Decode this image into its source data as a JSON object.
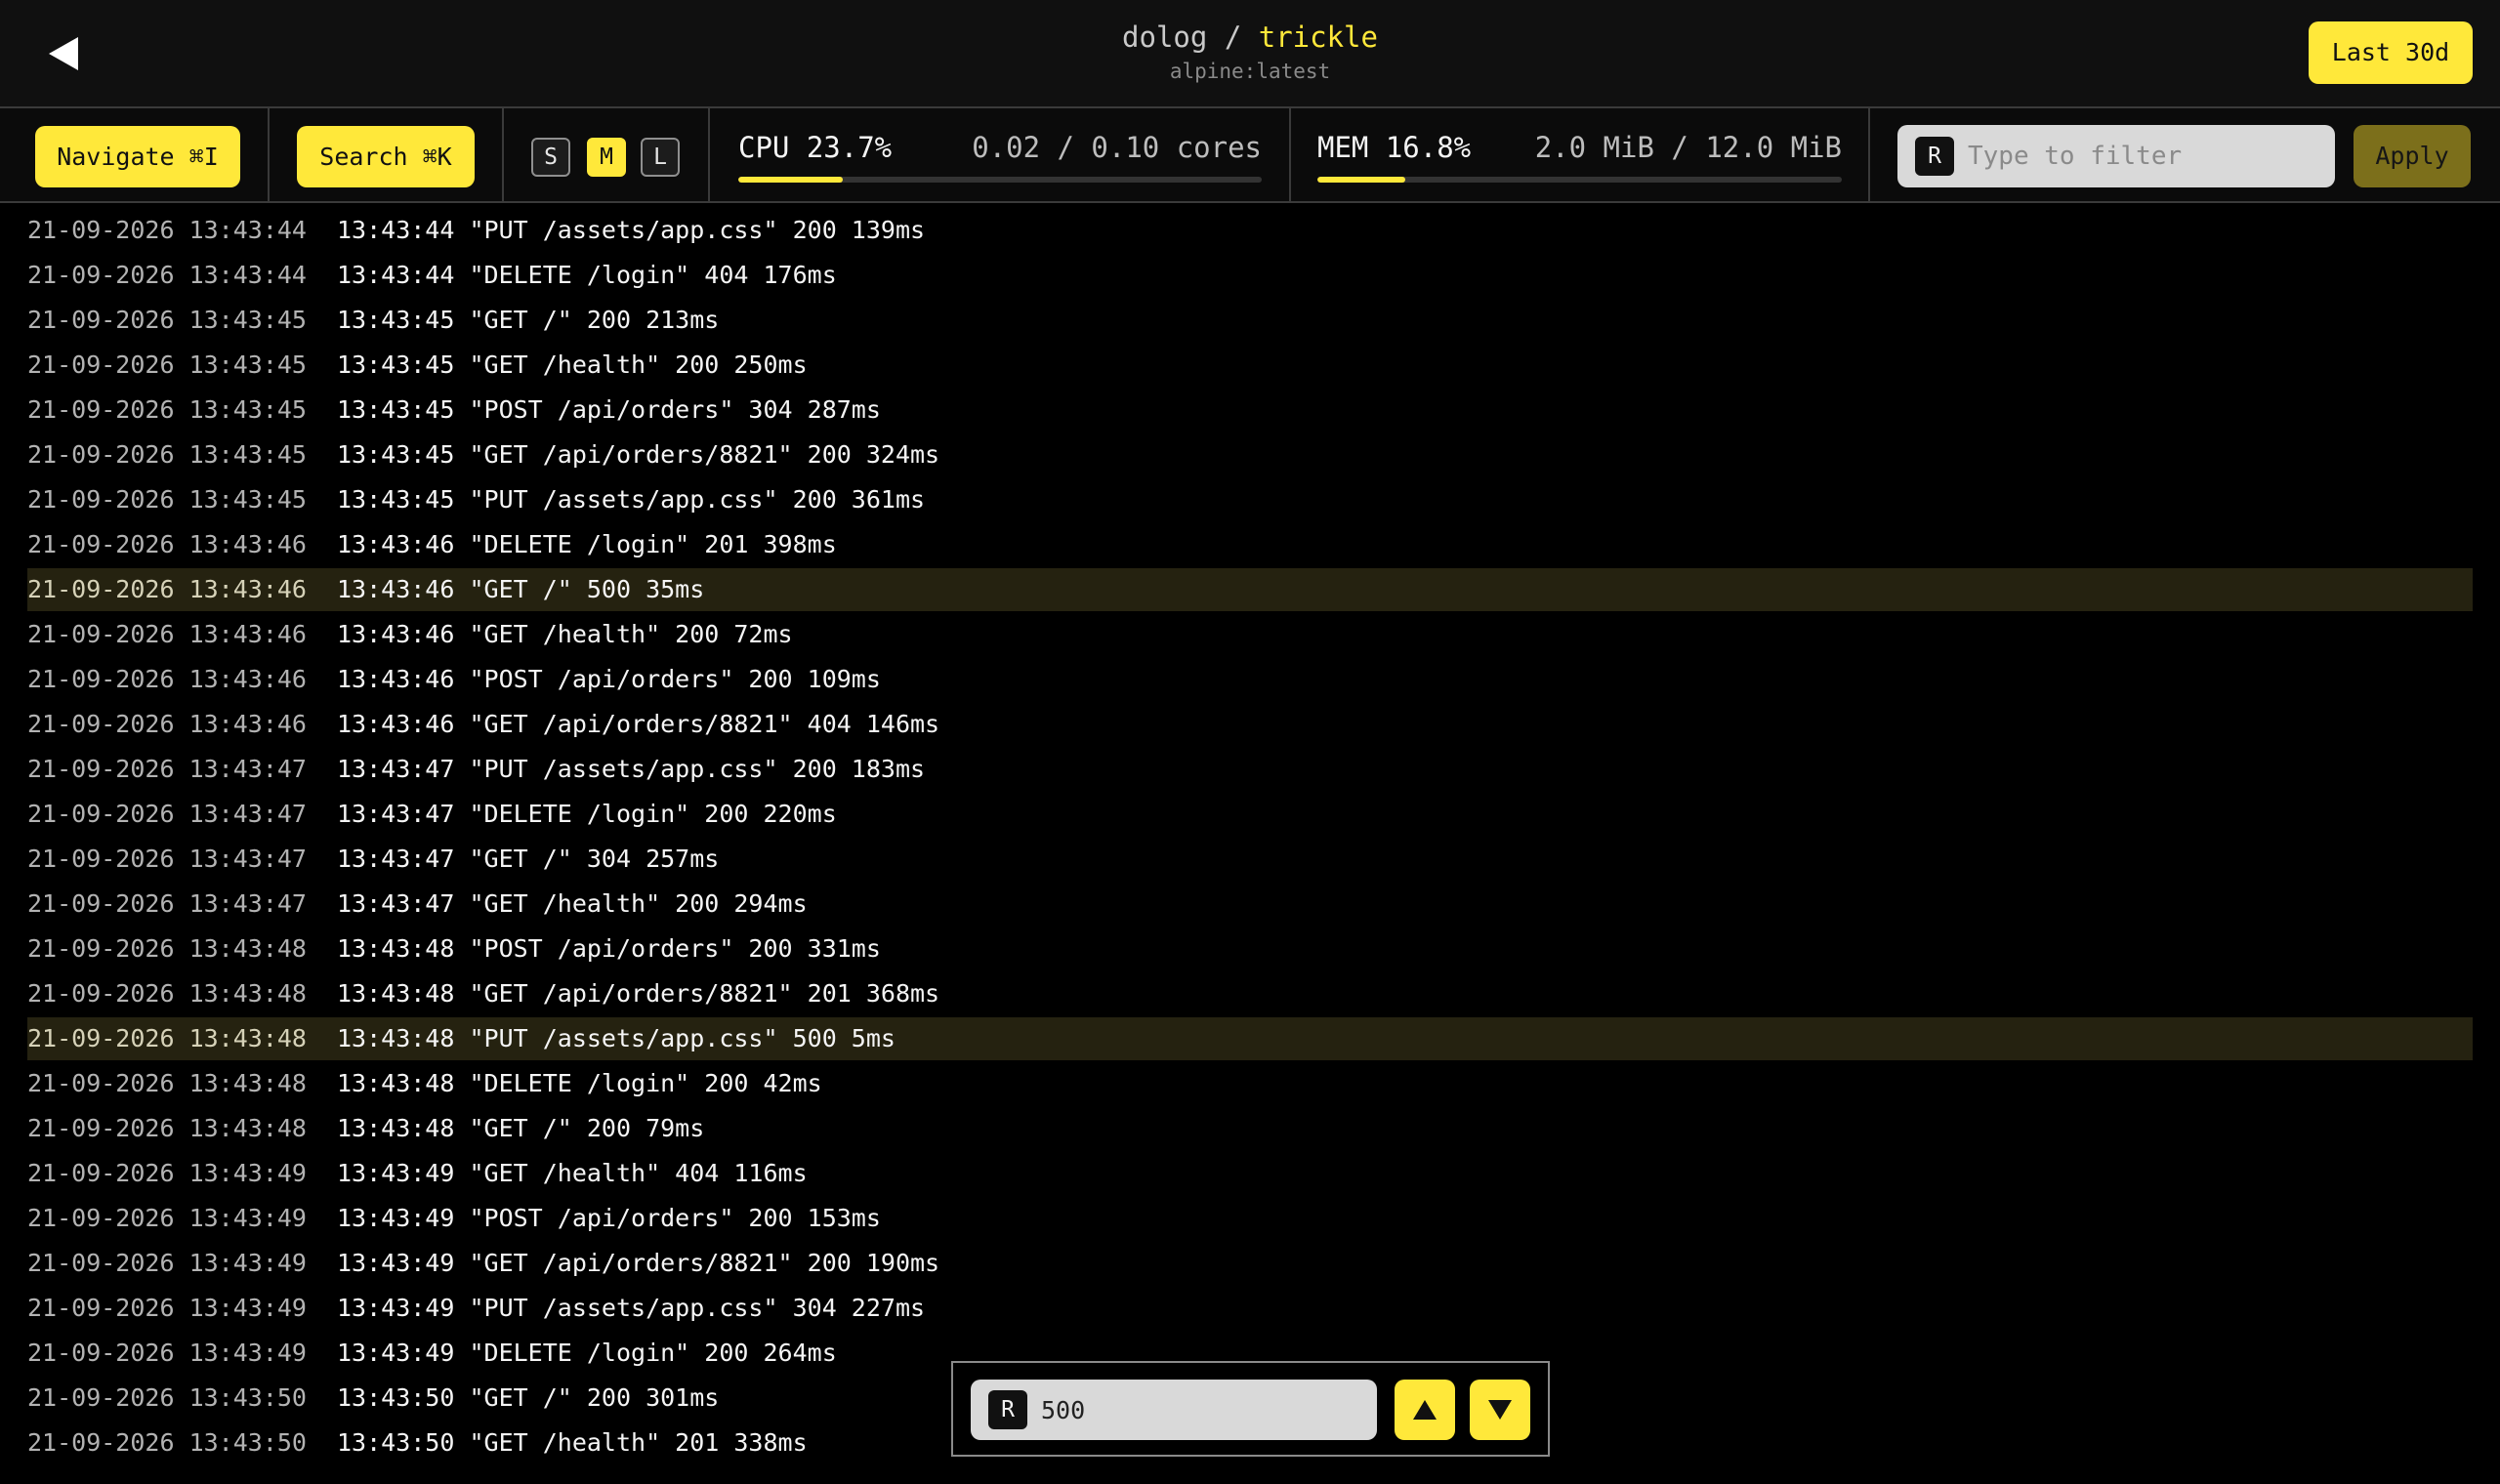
{
  "header": {
    "back_icon": "back-arrow-icon",
    "project": "dolog",
    "separator": "/",
    "container": "trickle",
    "image": "alpine:latest",
    "range_label": "Last 30d"
  },
  "toolbar": {
    "navigate_label": "Navigate ⌘I",
    "search_label": "Search ⌘K",
    "sizes": [
      "S",
      "M",
      "L"
    ],
    "active_size": "M",
    "cpu": {
      "label": "CPU 23.7%",
      "value": "0.02 / 0.10 cores",
      "fraction": 0.2
    },
    "mem": {
      "label": "MEM 16.8%",
      "value": "2.0 MiB / 12.0 MiB",
      "fraction": 0.167
    },
    "filter": {
      "badge": "R",
      "placeholder": "Type to filter",
      "value": ""
    },
    "apply_label": "Apply"
  },
  "logs": [
    {
      "ts": "21-09-2026 13:43:44",
      "msg": "13:43:44 \"PUT /assets/app.css\" 200 139ms",
      "highlight": false
    },
    {
      "ts": "21-09-2026 13:43:44",
      "msg": "13:43:44 \"DELETE /login\" 404 176ms",
      "highlight": false
    },
    {
      "ts": "21-09-2026 13:43:45",
      "msg": "13:43:45 \"GET /\" 200 213ms",
      "highlight": false
    },
    {
      "ts": "21-09-2026 13:43:45",
      "msg": "13:43:45 \"GET /health\" 200 250ms",
      "highlight": false
    },
    {
      "ts": "21-09-2026 13:43:45",
      "msg": "13:43:45 \"POST /api/orders\" 304 287ms",
      "highlight": false
    },
    {
      "ts": "21-09-2026 13:43:45",
      "msg": "13:43:45 \"GET /api/orders/8821\" 200 324ms",
      "highlight": false
    },
    {
      "ts": "21-09-2026 13:43:45",
      "msg": "13:43:45 \"PUT /assets/app.css\" 200 361ms",
      "highlight": false
    },
    {
      "ts": "21-09-2026 13:43:46",
      "msg": "13:43:46 \"DELETE /login\" 201 398ms",
      "highlight": false
    },
    {
      "ts": "21-09-2026 13:43:46",
      "msg": "13:43:46 \"GET /\" 500 35ms",
      "highlight": true
    },
    {
      "ts": "21-09-2026 13:43:46",
      "msg": "13:43:46 \"GET /health\" 200 72ms",
      "highlight": false
    },
    {
      "ts": "21-09-2026 13:43:46",
      "msg": "13:43:46 \"POST /api/orders\" 200 109ms",
      "highlight": false
    },
    {
      "ts": "21-09-2026 13:43:46",
      "msg": "13:43:46 \"GET /api/orders/8821\" 404 146ms",
      "highlight": false
    },
    {
      "ts": "21-09-2026 13:43:47",
      "msg": "13:43:47 \"PUT /assets/app.css\" 200 183ms",
      "highlight": false
    },
    {
      "ts": "21-09-2026 13:43:47",
      "msg": "13:43:47 \"DELETE /login\" 200 220ms",
      "highlight": false
    },
    {
      "ts": "21-09-2026 13:43:47",
      "msg": "13:43:47 \"GET /\" 304 257ms",
      "highlight": false
    },
    {
      "ts": "21-09-2026 13:43:47",
      "msg": "13:43:47 \"GET /health\" 200 294ms",
      "highlight": false
    },
    {
      "ts": "21-09-2026 13:43:48",
      "msg": "13:43:48 \"POST /api/orders\" 200 331ms",
      "highlight": false
    },
    {
      "ts": "21-09-2026 13:43:48",
      "msg": "13:43:48 \"GET /api/orders/8821\" 201 368ms",
      "highlight": false
    },
    {
      "ts": "21-09-2026 13:43:48",
      "msg": "13:43:48 \"PUT /assets/app.css\" 500 5ms",
      "highlight": true
    },
    {
      "ts": "21-09-2026 13:43:48",
      "msg": "13:43:48 \"DELETE /login\" 200 42ms",
      "highlight": false
    },
    {
      "ts": "21-09-2026 13:43:48",
      "msg": "13:43:48 \"GET /\" 200 79ms",
      "highlight": false
    },
    {
      "ts": "21-09-2026 13:43:49",
      "msg": "13:43:49 \"GET /health\" 404 116ms",
      "highlight": false
    },
    {
      "ts": "21-09-2026 13:43:49",
      "msg": "13:43:49 \"POST /api/orders\" 200 153ms",
      "highlight": false
    },
    {
      "ts": "21-09-2026 13:43:49",
      "msg": "13:43:49 \"GET /api/orders/8821\" 200 190ms",
      "highlight": false
    },
    {
      "ts": "21-09-2026 13:43:49",
      "msg": "13:43:49 \"PUT /assets/app.css\" 304 227ms",
      "highlight": false
    },
    {
      "ts": "21-09-2026 13:43:49",
      "msg": "13:43:49 \"DELETE /login\" 200 264ms",
      "highlight": false
    },
    {
      "ts": "21-09-2026 13:43:50",
      "msg": "13:43:50 \"GET /\" 200 301ms",
      "highlight": false
    },
    {
      "ts": "21-09-2026 13:43:50",
      "msg": "13:43:50 \"GET /health\" 201 338ms",
      "highlight": false
    }
  ],
  "navigator": {
    "badge": "R",
    "query": "500",
    "prev_icon": "arrow-up-icon",
    "next_icon": "arrow-down-icon"
  },
  "colors": {
    "accent": "#ffe83a",
    "background": "#000000",
    "header_bg": "#101010",
    "highlight_row": "#252210",
    "apply_button": "#7c6f1b"
  }
}
